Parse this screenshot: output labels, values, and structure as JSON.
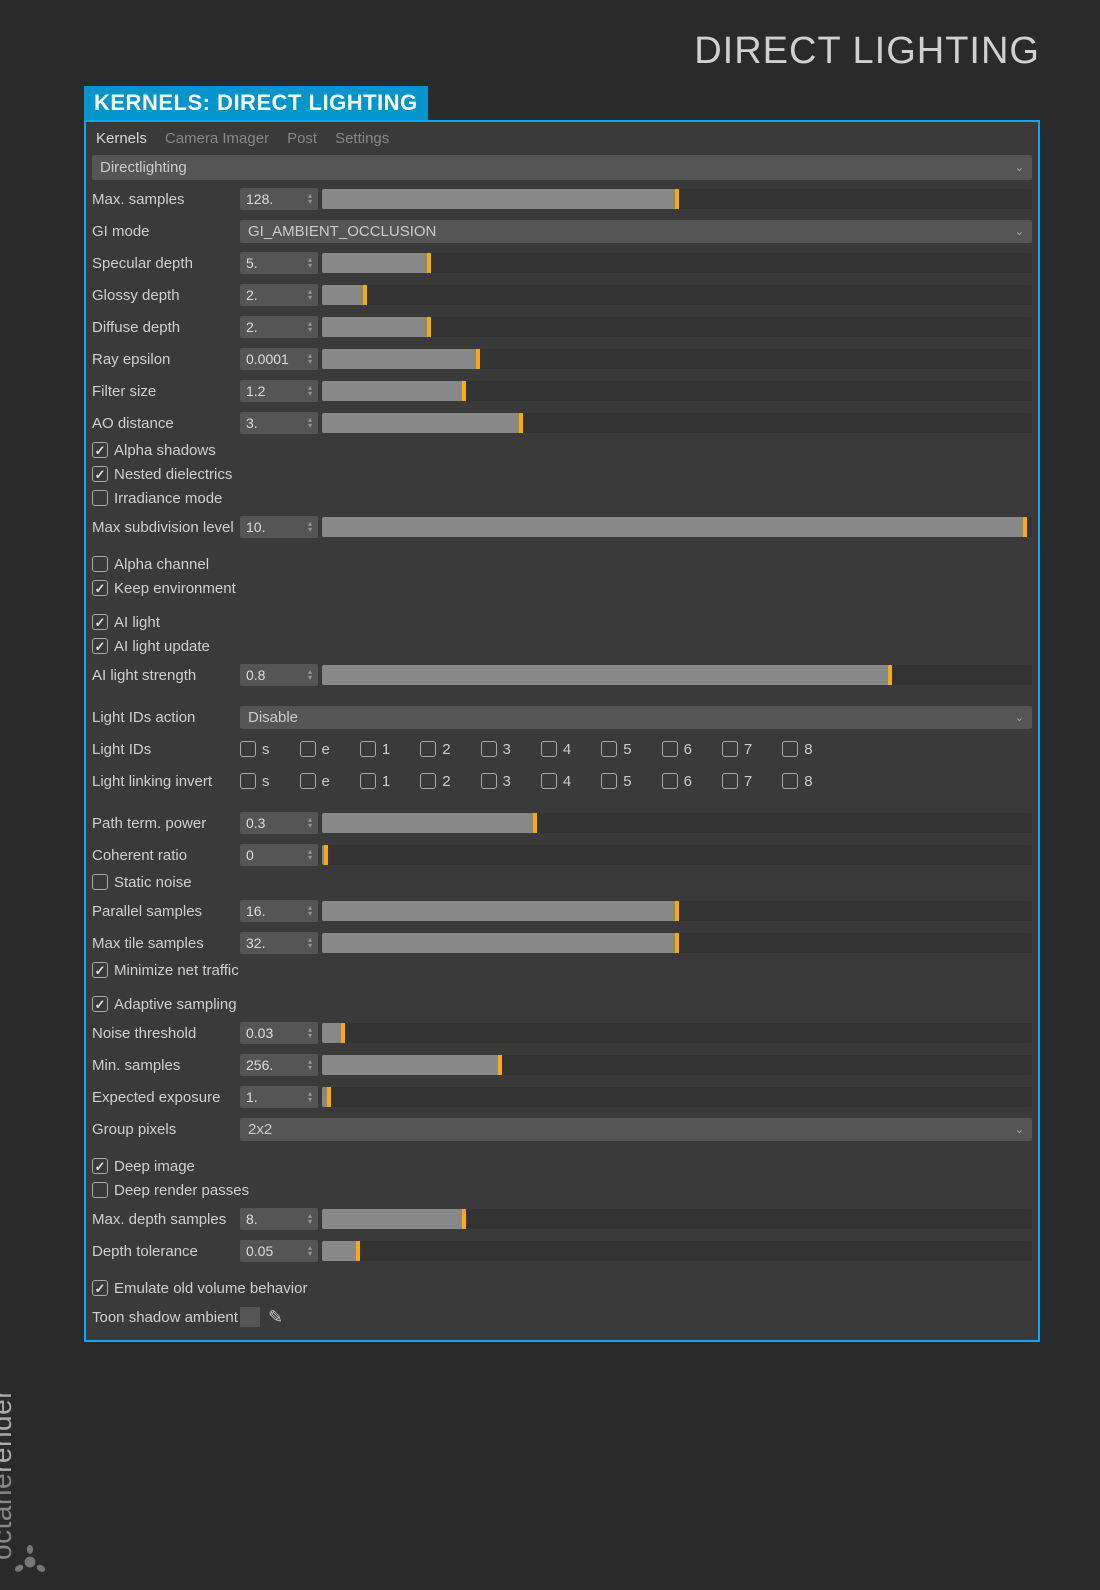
{
  "page_title": "DIRECT LIGHTING",
  "panel_header": "KERNELS: DIRECT LIGHTING",
  "tabs": [
    "Kernels",
    "Camera Imager",
    "Post",
    "Settings"
  ],
  "active_tab": "Kernels",
  "kernel_dropdown": "Directlighting",
  "gi_mode": "GI_AMBIENT_OCCLUSION",
  "light_ids_action": "Disable",
  "group_pixels": "2x2",
  "params": {
    "max_samples": {
      "label": "Max. samples",
      "value": "128.",
      "fill": 50
    },
    "specular_depth": {
      "label": "Specular depth",
      "value": "5.",
      "fill": 15
    },
    "glossy_depth": {
      "label": "Glossy depth",
      "value": "2.",
      "fill": 6
    },
    "diffuse_depth": {
      "label": "Diffuse depth",
      "value": "2.",
      "fill": 15
    },
    "ray_epsilon": {
      "label": "Ray epsilon",
      "value": "0.0001",
      "fill": 22
    },
    "filter_size": {
      "label": "Filter size",
      "value": "1.2",
      "fill": 20
    },
    "ao_distance": {
      "label": "AO distance",
      "value": "3.",
      "fill": 28
    },
    "max_subdiv": {
      "label": "Max subdivision level",
      "value": "10.",
      "fill": 99
    },
    "ai_light_strength": {
      "label": "AI light strength",
      "value": "0.8",
      "fill": 80
    },
    "path_term_power": {
      "label": "Path term. power",
      "value": "0.3",
      "fill": 30
    },
    "coherent_ratio": {
      "label": "Coherent ratio",
      "value": "0",
      "fill": 0.5
    },
    "parallel_samples": {
      "label": "Parallel samples",
      "value": "16.",
      "fill": 50
    },
    "max_tile_samples": {
      "label": "Max tile samples",
      "value": "32.",
      "fill": 50
    },
    "noise_threshold": {
      "label": "Noise threshold",
      "value": "0.03",
      "fill": 3
    },
    "min_samples": {
      "label": "Min. samples",
      "value": "256.",
      "fill": 25
    },
    "expected_exposure": {
      "label": "Expected exposure",
      "value": "1.",
      "fill": 1
    },
    "max_depth_samples": {
      "label": "Max. depth samples",
      "value": "8.",
      "fill": 20
    },
    "depth_tolerance": {
      "label": "Depth tolerance",
      "value": "0.05",
      "fill": 5
    }
  },
  "checks": {
    "alpha_shadows": {
      "label": "Alpha shadows",
      "checked": true
    },
    "nested_dielectrics": {
      "label": "Nested dielectrics",
      "checked": true
    },
    "irradiance_mode": {
      "label": "Irradiance mode",
      "checked": false
    },
    "alpha_channel": {
      "label": "Alpha channel",
      "checked": false
    },
    "keep_environment": {
      "label": "Keep environment",
      "checked": true
    },
    "ai_light": {
      "label": "AI light",
      "checked": true
    },
    "ai_light_update": {
      "label": "AI light update",
      "checked": true
    },
    "static_noise": {
      "label": "Static noise",
      "checked": false
    },
    "minimize_net_traffic": {
      "label": "Minimize net traffic",
      "checked": true
    },
    "adaptive_sampling": {
      "label": "Adaptive sampling",
      "checked": true
    },
    "deep_image": {
      "label": "Deep image",
      "checked": true
    },
    "deep_render_passes": {
      "label": "Deep render passes",
      "checked": false
    },
    "emulate_old_volume": {
      "label": "Emulate old volume behavior",
      "checked": true
    }
  },
  "light_ids_label": "Light IDs",
  "light_linking_label": "Light linking invert",
  "light_id_items": [
    "s",
    "e",
    "1",
    "2",
    "3",
    "4",
    "5",
    "6",
    "7",
    "8"
  ],
  "gi_mode_label": "GI mode",
  "light_ids_action_label": "Light IDs action",
  "group_pixels_label": "Group pixels",
  "toon_shadow_label": "Toon shadow ambient",
  "brand": "render",
  "brand_prefix": "octane"
}
